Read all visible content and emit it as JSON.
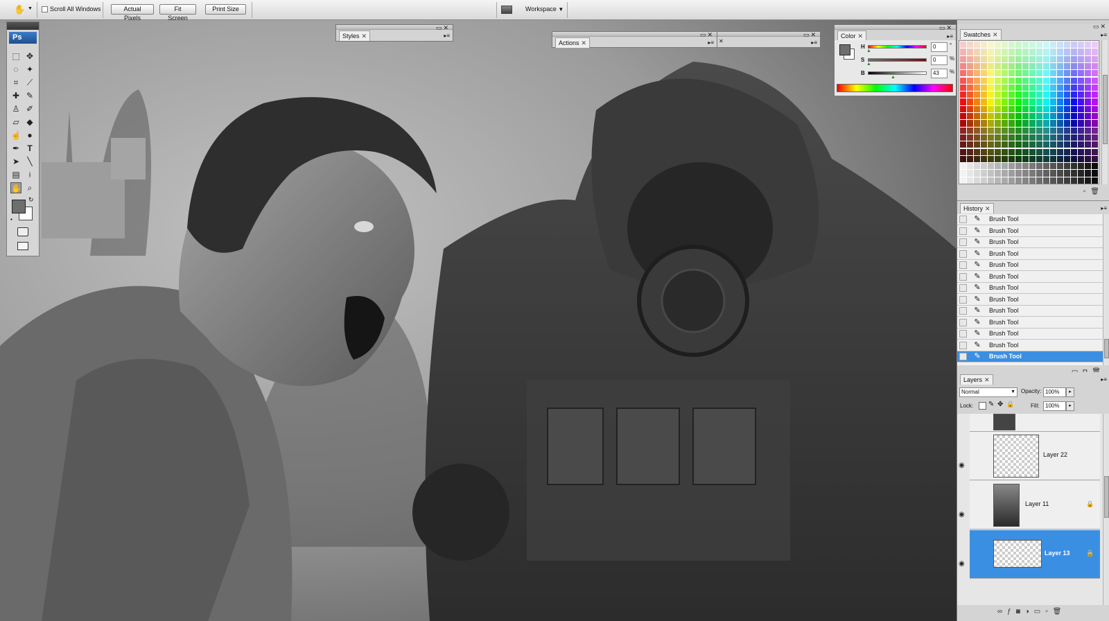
{
  "options_bar": {
    "hand_tool_icon": "hand-icon",
    "scroll_all_windows_label": "Scroll All Windows",
    "buttons": [
      "Actual Pixels",
      "Fit Screen",
      "Print Size"
    ],
    "workspace_label": "Workspace"
  },
  "tools": {
    "logo": "Ps"
  },
  "panels": {
    "styles": {
      "tab": "Styles"
    },
    "actions": {
      "tab": "Actions"
    },
    "color": {
      "tab": "Color",
      "channels": [
        {
          "label": "H",
          "value": "0",
          "unit": "°"
        },
        {
          "label": "S",
          "value": "0",
          "unit": "%"
        },
        {
          "label": "B",
          "value": "43",
          "unit": "%"
        }
      ]
    },
    "swatches": {
      "tab": "Swatches"
    },
    "history": {
      "tab": "History",
      "items": [
        "Brush Tool",
        "Brush Tool",
        "Brush Tool",
        "Brush Tool",
        "Brush Tool",
        "Brush Tool",
        "Brush Tool",
        "Brush Tool",
        "Brush Tool",
        "Brush Tool",
        "Brush Tool",
        "Brush Tool",
        "Brush Tool"
      ],
      "selected_index": 12
    },
    "layers": {
      "tab": "Layers",
      "blend_mode": "Normal",
      "opacity_label": "Opacity:",
      "opacity_value": "100%",
      "lock_label": "Lock:",
      "fill_label": "Fill:",
      "fill_value": "100%",
      "layers": [
        {
          "name": "Layer 22",
          "visible": true,
          "locked": false,
          "selected": false
        },
        {
          "name": "Layer 11",
          "visible": true,
          "locked": true,
          "selected": false
        },
        {
          "name": "Layer 13",
          "visible": true,
          "locked": true,
          "selected": true
        }
      ]
    }
  },
  "colors": {
    "selection": "#3b8fe3",
    "foreground_swatch": "#6e6e6e",
    "background_swatch": "#ffffff"
  }
}
